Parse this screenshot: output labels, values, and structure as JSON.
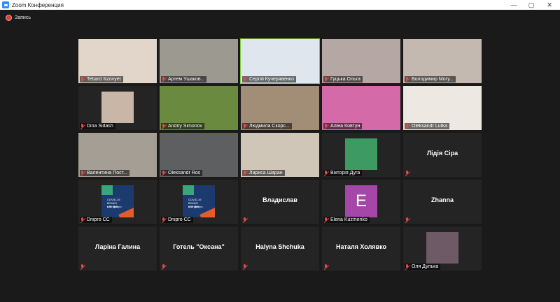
{
  "window": {
    "title": "Zoom Конференция",
    "controls": [
      "—",
      "▢",
      "✕"
    ]
  },
  "recording": {
    "label": "Запись"
  },
  "participants": [
    {
      "name": "Tebard Ilizovyet",
      "kind": "video",
      "bg": "#e2d6cb"
    },
    {
      "name": "Артем Ушаков...",
      "kind": "video",
      "bg": "#9c9a90"
    },
    {
      "name": "Сергій Кучерявенко",
      "kind": "video",
      "bg": "#dfe6ee",
      "active": true
    },
    {
      "name": "Гуцька Ольга",
      "kind": "video",
      "bg": "#b4a7a4"
    },
    {
      "name": "Володимир Могу...",
      "kind": "video",
      "bg": "#c3b9b0"
    },
    {
      "name": "Dina Sidash",
      "kind": "thumb",
      "bg": "#c9b6a6"
    },
    {
      "name": "Andriy Simonov",
      "kind": "video",
      "bg": "#6a8b3f"
    },
    {
      "name": "Людмила Скорс...",
      "kind": "video",
      "bg": "#a28d76"
    },
    {
      "name": "Аліна Ковтун",
      "kind": "video",
      "bg": "#d56aa8"
    },
    {
      "name": "Oleksandr Lutka",
      "kind": "video",
      "bg": "#ede8e1"
    },
    {
      "name": "Валентина Пост...",
      "kind": "video",
      "bg": "#a59e94"
    },
    {
      "name": "Oleksandr Ros",
      "kind": "video",
      "bg": "#5d5f60"
    },
    {
      "name": "Лариса Шаран",
      "kind": "video",
      "bg": "#cfc6b8"
    },
    {
      "name": "Вікторія Дуга",
      "kind": "thumb",
      "bg": "#3c9a62"
    },
    {
      "name": "Лідія Сіра",
      "kind": "text"
    },
    {
      "name": "Dnipro CC",
      "kind": "covid"
    },
    {
      "name": "Dnipro CC",
      "kind": "covid"
    },
    {
      "name": "Владислав",
      "kind": "text"
    },
    {
      "name": "Elena Kuzmenko",
      "kind": "avatar",
      "letter": "E",
      "bg": "#a547a8"
    },
    {
      "name": "Zhanna",
      "kind": "text"
    },
    {
      "name": "Ларіна Галина",
      "kind": "text"
    },
    {
      "name": "Готель \"Оксана\"",
      "kind": "text"
    },
    {
      "name": "Halyna Shchuka",
      "kind": "text"
    },
    {
      "name": "Наталя Холявко",
      "kind": "text"
    },
    {
      "name": "Оля Дулька",
      "kind": "thumb",
      "bg": "#6d5a66"
    }
  ],
  "covid_card": {
    "line1": "COVID-19",
    "line2": "ВОНКО КЛІНІКА",
    "line3": "в м. Дніпро"
  },
  "colors": {
    "background": "#1a1a1a",
    "tile": "#242424",
    "active_speaker": "#7dcf3a",
    "muted_mic": "#e34b4b"
  }
}
